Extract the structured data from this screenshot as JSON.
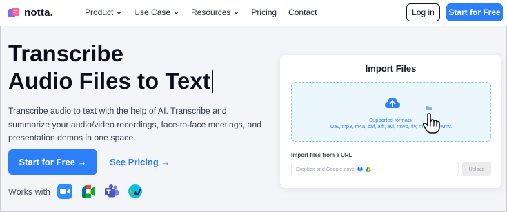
{
  "brand": {
    "name": "notta."
  },
  "nav": {
    "items": [
      {
        "label": "Product",
        "has_dropdown": true
      },
      {
        "label": "Use Case",
        "has_dropdown": true
      },
      {
        "label": "Resources",
        "has_dropdown": true
      },
      {
        "label": "Pricing",
        "has_dropdown": false
      },
      {
        "label": "Contact",
        "has_dropdown": false
      }
    ],
    "login_label": "Log in",
    "start_label": "Start for Free"
  },
  "hero": {
    "title_line1": "Transcribe",
    "title_line2": "Audio Files to Text",
    "description": "Transcribe audio to text with the help of AI. Transcribe and summarize your audio/video recordings, face-to-face meetings, and presentation demos in one space.",
    "primary_cta": "Start for Free →",
    "secondary_cta": "See Pricing →",
    "works_with_label": "Works with",
    "apps": [
      "zoom-icon",
      "google-meet-icon",
      "microsoft-teams-icon",
      "webex-icon"
    ]
  },
  "import_card": {
    "title": "Import Files",
    "supported_label": "Supported formats:",
    "formats": "wav, mp3, m4a, caf, aiff, avi, rmvb, flv, m          , wmv.",
    "url_label": "Import files from a URL",
    "url_placeholder": "Dropbox and Google drive",
    "upload_label": "Upload"
  },
  "colors": {
    "accent": "#2d7ff9",
    "dropzone_bg": "#ecf6fd",
    "dropzone_border": "#8ec4ea"
  }
}
